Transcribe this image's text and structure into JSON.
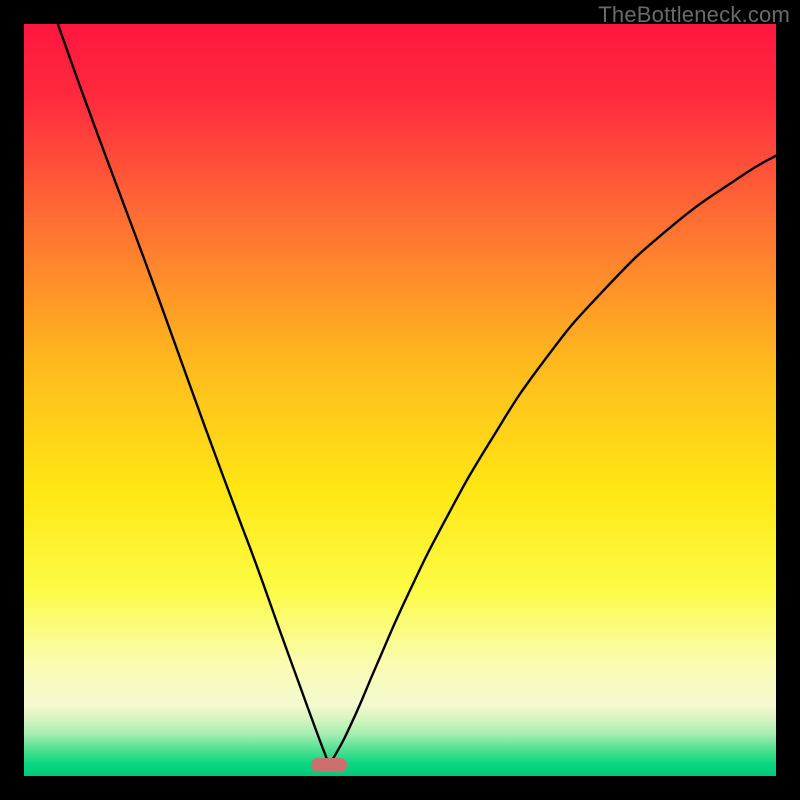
{
  "watermark": "TheBottleneck.com",
  "chart_data": {
    "type": "line",
    "title": "",
    "xlabel": "",
    "ylabel": "",
    "xlim": [
      0,
      1
    ],
    "ylim": [
      0,
      1
    ],
    "note": "Bottleneck curve: |x - x0|^p style V-shaped minimum. Background gradient encodes bottleneck severity (green near bottom = 0%, red near top = 100%). No numeric axes shown in source image.",
    "minimum_x_fraction": 0.405,
    "marker": {
      "x_fraction": 0.405,
      "y_fraction": 0.985,
      "color": "#cc6f6e"
    },
    "gradient_stops": [
      {
        "pos": 0.0,
        "color": "#ff163f"
      },
      {
        "pos": 0.1,
        "color": "#ff2b3e"
      },
      {
        "pos": 0.25,
        "color": "#ff6a34"
      },
      {
        "pos": 0.45,
        "color": "#ffb91e"
      },
      {
        "pos": 0.62,
        "color": "#ffe714"
      },
      {
        "pos": 0.75,
        "color": "#fcfb45"
      },
      {
        "pos": 0.85,
        "color": "#fafcb0"
      },
      {
        "pos": 0.905,
        "color": "#f4f9d0"
      },
      {
        "pos": 0.925,
        "color": "#d6f4c0"
      },
      {
        "pos": 0.945,
        "color": "#a3edb0"
      },
      {
        "pos": 0.965,
        "color": "#4fe091"
      },
      {
        "pos": 0.985,
        "color": "#08d67f"
      },
      {
        "pos": 1.0,
        "color": "#02c877"
      }
    ],
    "series": [
      {
        "name": "bottleneck-curve",
        "points_xy_fraction": [
          [
            0.045,
            0.0
          ],
          [
            0.08,
            0.098
          ],
          [
            0.12,
            0.206
          ],
          [
            0.16,
            0.313
          ],
          [
            0.2,
            0.423
          ],
          [
            0.24,
            0.534
          ],
          [
            0.28,
            0.642
          ],
          [
            0.31,
            0.722
          ],
          [
            0.34,
            0.806
          ],
          [
            0.365,
            0.875
          ],
          [
            0.385,
            0.93
          ],
          [
            0.4,
            0.97
          ],
          [
            0.405,
            0.98
          ],
          [
            0.415,
            0.97
          ],
          [
            0.44,
            0.92
          ],
          [
            0.47,
            0.85
          ],
          [
            0.51,
            0.76
          ],
          [
            0.56,
            0.66
          ],
          [
            0.62,
            0.555
          ],
          [
            0.69,
            0.45
          ],
          [
            0.77,
            0.355
          ],
          [
            0.86,
            0.27
          ],
          [
            0.95,
            0.205
          ],
          [
            1.0,
            0.175
          ]
        ]
      }
    ]
  }
}
